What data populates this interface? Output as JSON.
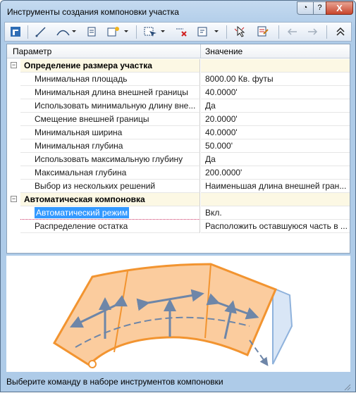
{
  "window": {
    "title": "Инструменты создания компоновки участка",
    "buttons": {
      "pin": "◔",
      "help": "?",
      "close": "X"
    }
  },
  "toolbar": {
    "icons": [
      "layout-tools-icon",
      "line-draw-icon",
      "curve-draw-icon",
      "page-icon",
      "settings-icon",
      "select-icon",
      "delete-icon",
      "edit-icon",
      "pointer-icon",
      "sheet-edit-icon",
      "undo-icon",
      "redo-icon",
      "collapse-icon"
    ]
  },
  "grid": {
    "header": {
      "param": "Параметр",
      "value": "Значение"
    },
    "categories": [
      {
        "label": "Определение размера участка",
        "expander": "−",
        "rows": [
          {
            "name": "Минимальная площадь",
            "value": "8000.00 Кв. футы"
          },
          {
            "name": "Минимальная длина внешней границы",
            "value": "40.0000'"
          },
          {
            "name": "Использовать минимальную длину вне...",
            "value": "Да"
          },
          {
            "name": "Смещение внешней границы",
            "value": "20.0000'"
          },
          {
            "name": "Минимальная ширина",
            "value": "40.0000'"
          },
          {
            "name": "Минимальная глубина",
            "value": "50.000'"
          },
          {
            "name": "Использовать максимальную глубину",
            "value": "Да"
          },
          {
            "name": "Максимальная глубина",
            "value": "200.0000'"
          },
          {
            "name": "Выбор из нескольких решений",
            "value": "Наименьшая длина внешней гран..."
          }
        ]
      },
      {
        "label": "Автоматическая компоновка",
        "expander": "−",
        "rows": [
          {
            "name": "Автоматический режим",
            "value": "Вкл."
          },
          {
            "name": "Распределение остатка",
            "value": "Расположить оставшуюся часть в ..."
          }
        ]
      }
    ]
  },
  "status": {
    "text": "Выберите команду в наборе инструментов компоновки"
  },
  "colors": {
    "accent": "#f29430",
    "fill": "#fbcc9e",
    "arrow": "#6e86a8",
    "selection": "#3399ff",
    "category_bg": "#fcf8e4"
  }
}
